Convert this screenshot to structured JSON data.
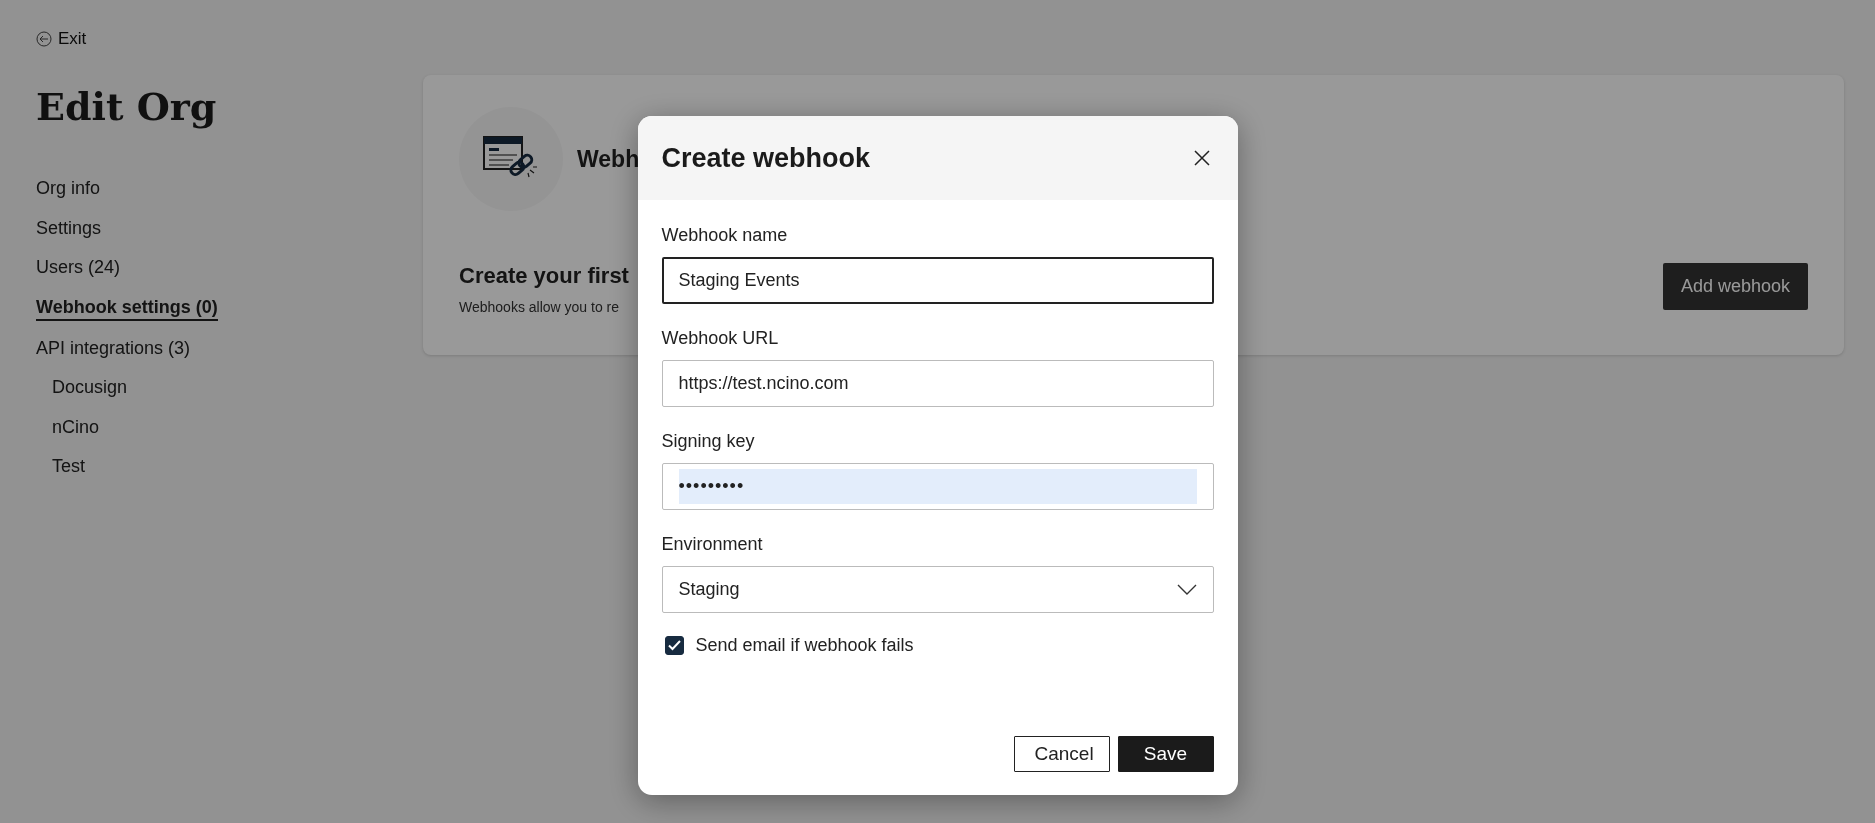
{
  "exit_link": {
    "label": "Exit"
  },
  "page_title": "Edit Org",
  "sidebar": {
    "items": [
      {
        "label": "Org info",
        "selected": false
      },
      {
        "label": "Settings",
        "selected": false
      },
      {
        "label": "Users (24)",
        "selected": false
      },
      {
        "label": "Webhook settings (0)",
        "selected": true
      },
      {
        "label": "API integrations (3)",
        "selected": false,
        "children": [
          {
            "label": "Docusign",
            "selected": false
          },
          {
            "label": "nCino",
            "selected": false
          },
          {
            "label": "Test",
            "selected": false
          }
        ]
      }
    ]
  },
  "card": {
    "title": "Webh",
    "heading": "Create your first",
    "description": "Webhooks allow you to re",
    "button": "Add webhook"
  },
  "dialog": {
    "title": "Create webhook",
    "fields": [
      {
        "kind": "text",
        "label": "Webhook name",
        "value": "Staging Events",
        "focused": true
      },
      {
        "kind": "text",
        "label": "Webhook URL",
        "value": "https://test.ncino.com",
        "focused": false
      },
      {
        "kind": "password",
        "label": "Signing key",
        "value": "•••••••••",
        "focused": false,
        "text_selected": true
      },
      {
        "kind": "select",
        "label": "Environment",
        "value": "Staging",
        "focused": false
      }
    ],
    "checkbox": {
      "label": "Send email if webhook fails",
      "checked": true
    },
    "buttons": [
      {
        "kind": "secondary",
        "label": "Cancel"
      },
      {
        "kind": "primary",
        "label": "Save"
      }
    ]
  }
}
